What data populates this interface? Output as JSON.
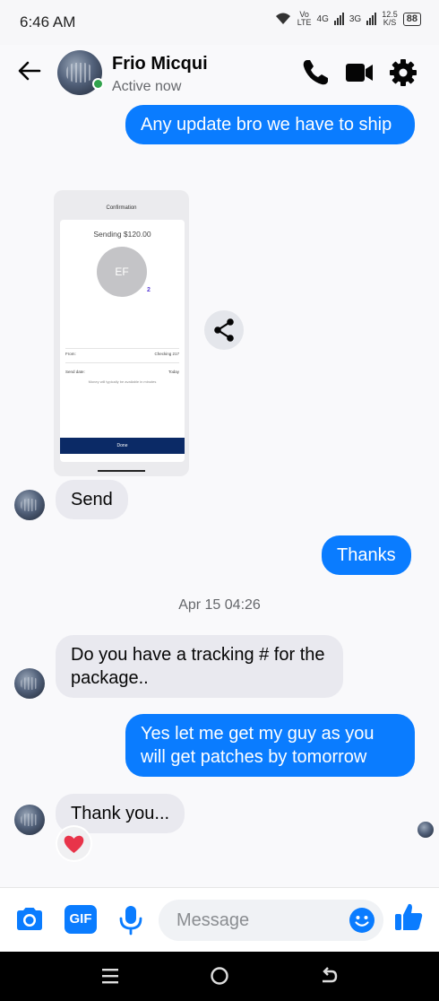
{
  "status_bar": {
    "time": "6:46 AM",
    "volte_top": "Vo",
    "volte_bottom": "LTE",
    "net1": "4G",
    "net2": "3G",
    "speed_top": "12.5",
    "speed_bottom": "K/S",
    "battery": "88"
  },
  "header": {
    "contact_name": "Frio Micqui",
    "status": "Active now"
  },
  "messages": {
    "m1": "Any update bro we have to ship",
    "m2": "Send",
    "m3": "Thanks",
    "timestamp": "Apr 15 04:26",
    "m4": "Do you have a tracking # for the package..",
    "m5": "Yes let me get my guy as you will get patches by tomorrow",
    "m6": "Thank you..."
  },
  "attachment": {
    "title": "Confirmation",
    "sending": "Sending $120.00",
    "initials": "EF",
    "badge": "2",
    "from_label": "From:",
    "from_value": "Checking 217",
    "date_label": "Send date:",
    "date_value": "Today",
    "note": "Money will typically be available in minutes",
    "done": "Done"
  },
  "composer": {
    "gif_label": "GIF",
    "placeholder": "Message"
  },
  "colors": {
    "accent": "#0a7cff",
    "incoming_bubble": "#e9e9ef",
    "online": "#31a24c"
  }
}
